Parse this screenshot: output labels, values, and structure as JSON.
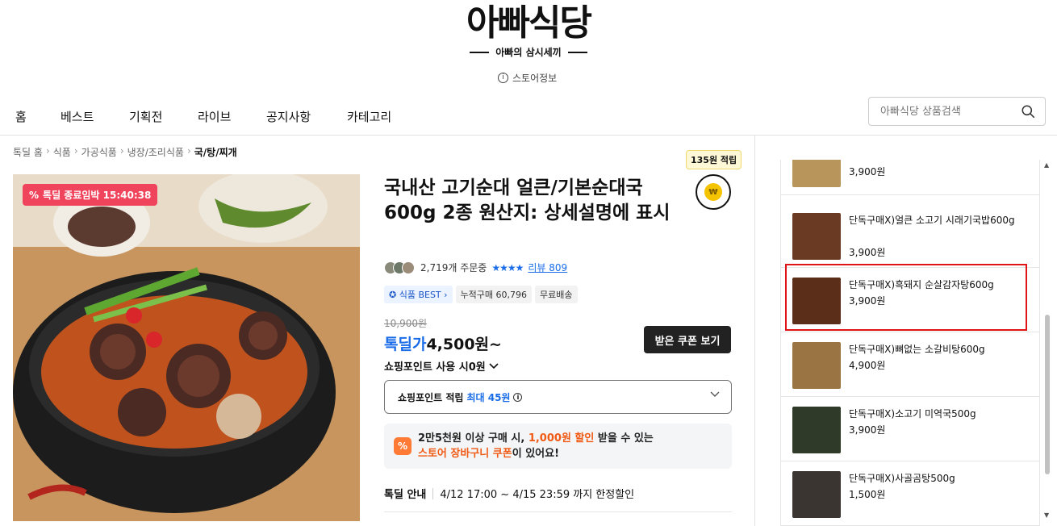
{
  "header": {
    "logo_main": "아빠식당",
    "logo_sub": "아빠의 삼시세끼",
    "store_info": "스토어정보",
    "search_placeholder": "아빠식당 상품검색"
  },
  "nav": [
    "홈",
    "베스트",
    "기획전",
    "라이브",
    "공지사항",
    "카테고리"
  ],
  "breadcrumb": [
    "톡딜 홈",
    "식품",
    "가공식품",
    "냉장/조리식품",
    "국/탕/찌개"
  ],
  "product": {
    "deal_badge": "톡딜 종료임박 15:40:38",
    "points_badge": "135원 적립",
    "title": "국내산 고기순대 얼큰/기본순대국600g 2종 원산지: 상세설명에 표시",
    "order_count": "2,719개 주문중",
    "stars": "★★★★",
    "review": "리뷰 809",
    "tags": [
      "식품 BEST",
      "누적구매 60,796",
      "무료배송"
    ],
    "price_original": "10,900원",
    "price_label": "톡딜가",
    "price_value": "4,500원~",
    "coupon_button": "받은 쿠폰 보기",
    "point_use": "쇼핑포인트 사용 시0원",
    "point_dropdown_label": "쇼핑포인트 적립",
    "point_dropdown_max": "최대 45원",
    "promo_part1": "2만5천원 이상 구매 시, ",
    "promo_highlight1": "1,000원 할인",
    "promo_part2": " 받을 수 있는",
    "promo_highlight2": "스토어 장바구니 쿠폰",
    "promo_part3": "이 있어요!",
    "deal_info_label": "톡딜 안내",
    "deal_info_text": "4/12 17:00 ~ 4/15 23:59 까지 한정할인"
  },
  "related": [
    {
      "name": "",
      "price": "3,900원"
    },
    {
      "name": "단독구매X)얼큰 소고기 시래기국밥600g",
      "price": "3,900원"
    },
    {
      "name": "단독구매X)흑돼지 순살감자탕600g",
      "price": "3,900원"
    },
    {
      "name": "단독구매X)뼈없는 소갈비탕600g",
      "price": "4,900원"
    },
    {
      "name": "단독구매X)소고기 미역국500g",
      "price": "3,900원"
    },
    {
      "name": "단독구매X)사골곰탕500g",
      "price": "1,500원"
    }
  ],
  "colors": {
    "accent": "#1a6ce8",
    "deal": "#f0435c",
    "highlight": "#e01414",
    "promo": "#f05a15"
  }
}
